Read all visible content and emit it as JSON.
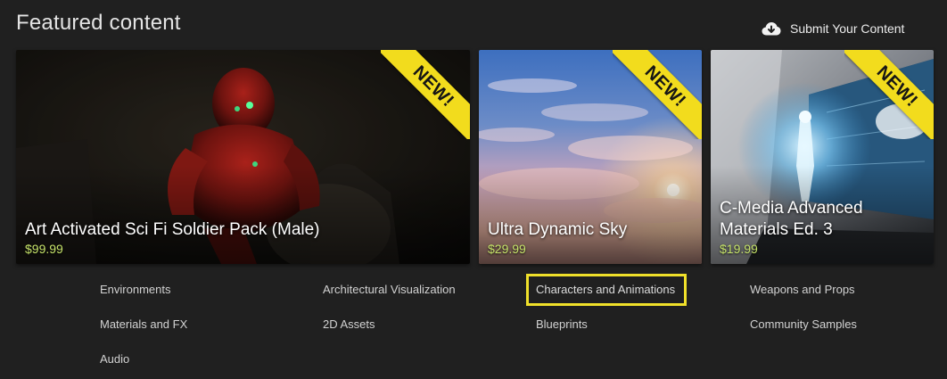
{
  "header": {
    "title": "Featured content",
    "submit_label": "Submit Your Content",
    "submit_icon": "cloud-download-icon"
  },
  "cards": [
    {
      "title": "Art Activated Sci Fi Soldier Pack (Male)",
      "price": "$99.99",
      "badge": "NEW!"
    },
    {
      "title": "Ultra Dynamic Sky",
      "price": "$29.99",
      "badge": "NEW!"
    },
    {
      "title": "C-Media Advanced Materials Ed. 3",
      "price": "$19.99",
      "badge": "NEW!"
    }
  ],
  "categories": [
    {
      "label": "Environments"
    },
    {
      "label": "Architectural Visualization"
    },
    {
      "label": "Characters and Animations",
      "selected": true
    },
    {
      "label": "Weapons and Props"
    },
    {
      "label": "Materials and FX"
    },
    {
      "label": "2D Assets"
    },
    {
      "label": "Blueprints"
    },
    {
      "label": "Community Samples"
    },
    {
      "label": "Audio"
    }
  ],
  "colors": {
    "background": "#202020",
    "price": "#c6e36a",
    "badge": "#f2dc1d",
    "selection_outline": "#f0e02a"
  }
}
